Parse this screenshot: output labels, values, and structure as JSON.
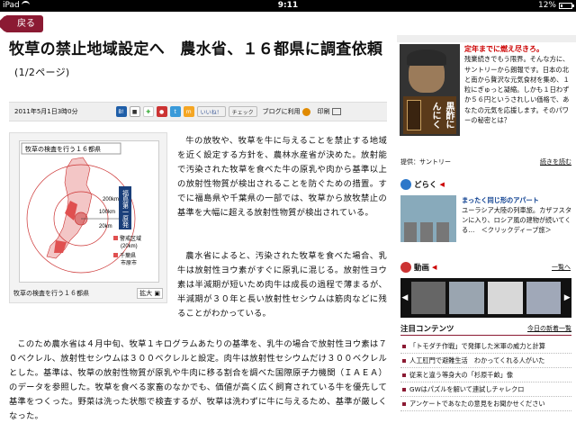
{
  "status_bar": {
    "device": "iPad",
    "time": "9:11",
    "battery": "12%"
  },
  "nav": {
    "back_label": "戻る"
  },
  "article": {
    "title": "牧草の禁止地域設定へ　農水省、１６都県に調査依頼",
    "page": "(1/2ページ)",
    "date": "2011年5月1日3時0分",
    "share": {
      "fb_like": "いいね！",
      "check": "チェック",
      "blog": "ブログに利用",
      "print": "印刷"
    },
    "figure": {
      "map_title": "牧草の検査を行う１６都県",
      "labels": [
        "200km",
        "100km",
        "20km",
        "警戒区域",
        "(20km)",
        "福島第一原発",
        "千葉県",
        "市原市"
      ],
      "caption": "牧草の検査を行う１６都県",
      "zoom": "拡大"
    },
    "paragraphs": [
      "牛の放牧や、牧草を牛に与えることを禁止する地域を近く設定する方針を、農林水産省が決めた。放射能で汚染された牧草を食べた牛の原乳や肉から基準以上の放射性物質が検出されることを防ぐための措置。すでに福島県や千葉県の一部では、牧草から放牧禁止の基準を大幅に超える放射性物質が検出されている。",
      "農水省によると、汚染された牧草を食べた場合、乳牛は放射性ヨウ素がすぐに原乳に混じる。放射性ヨウ素は半減期が短いため肉牛は成長の過程で薄まるが、半減期が３０年と長い放射性セシウムは筋肉などに残ることがわかっている。",
      "このため農水省は４月中旬、牧草１キログラムあたりの基準を、乳牛の場合で放射性ヨウ素は７０ベクレル、放射性セシウムは３００ベクレルと設定。肉牛は放射性セシウムだけ３００ベクレルとした。基準は、牧草の放射性物質が原乳や牛肉に移る割合を調べた国際原子力機関（ＩＡＥＡ）のデータを参照した。牧草を食べる家畜のなかでも、価値が高く広く飼育されている牛を優先して基準をつくった。野菜は洗った状態で検査するが、牧草は洗わずに牛に与えるため、基準が厳しくなった。"
    ]
  },
  "sidebar": {
    "ad": {
      "headline": "定年までに燃え尽きろ。",
      "body": "残業続きでもう限界。そんな方に、サントリーから朗報です。日本の北と南から贅沢な元気食材を集め、１粒にぎゅっと凝縮。しかも１日わずか５６円というされしい価格で、あなたの元気を応援します。そのパワーの秘密とは？",
      "can_label": "黒酢にんにく",
      "provider": "提供：サントリー",
      "more": "続きを読む"
    },
    "dorakiu": {
      "title": "どらく",
      "item_title": "まったく同じ形のアパート",
      "item_body": "ユーラシア大陸の列車旅。カザフスタンに入り、ロシア風の建物が続いてくる…　＜クリックディープ旅＞"
    },
    "douga": {
      "title": "動画",
      "list_link": "一覧へ"
    },
    "topics": {
      "title": "注目コンテンツ",
      "new_link": "今日の新着一覧",
      "items": [
        "「トモダチ作戦」で発揮した米軍の威力と計算",
        "人工肛門で避難生活　わかってくれる人がいた",
        "従来と違う等身大の「杉原千畝」像",
        "GWはパズルを解いて連試しチャレクロ",
        "アンケートであなたの意見をお聞かせください"
      ]
    }
  },
  "colors": {
    "accent": "#8b1a33",
    "link_blue": "#0a3d8f"
  }
}
